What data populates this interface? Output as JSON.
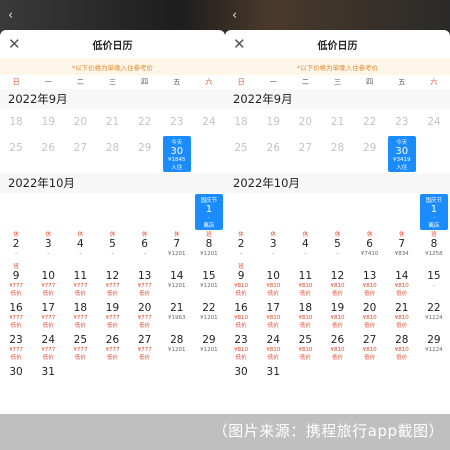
{
  "left": {
    "title": "低价日历",
    "notice": "*以下价格为单晚入住参考价",
    "weekdays": [
      "日",
      "一",
      "二",
      "三",
      "四",
      "五",
      "六"
    ],
    "sep": {
      "header": "2022年9月",
      "row1": [
        "18",
        "19",
        "20",
        "21",
        "22",
        "23",
        "24"
      ],
      "row2": [
        "25",
        "26",
        "27",
        "28",
        "29"
      ],
      "today": {
        "tag": "今天",
        "day": "30",
        "price": "¥1845",
        "note": "入住"
      }
    },
    "oct": {
      "header": "2022年10月",
      "holiday": {
        "tag": "国庆节",
        "day": "1",
        "price": "-",
        "note": "离店"
      },
      "r1": [
        {
          "tag": "休",
          "d": "2",
          "p": "-"
        },
        {
          "tag": "休",
          "d": "3",
          "p": "-"
        },
        {
          "tag": "休",
          "d": "4",
          "p": "-"
        },
        {
          "tag": "休",
          "d": "5",
          "p": "-"
        },
        {
          "tag": "休",
          "d": "6",
          "p": "-"
        },
        {
          "tag": "休",
          "d": "7",
          "p": "¥1201"
        },
        {
          "tag": "班",
          "d": "8",
          "p": "¥1201"
        }
      ],
      "r2": [
        {
          "tag": "班",
          "d": "9",
          "p": "¥777",
          "lo": "低价"
        },
        {
          "tag": "",
          "d": "10",
          "p": "¥777",
          "lo": "低价"
        },
        {
          "tag": "",
          "d": "11",
          "p": "¥777",
          "lo": "低价"
        },
        {
          "tag": "",
          "d": "12",
          "p": "¥777",
          "lo": "低价"
        },
        {
          "tag": "",
          "d": "13",
          "p": "¥777",
          "lo": "低价"
        },
        {
          "tag": "",
          "d": "14",
          "p": "¥1201"
        },
        {
          "tag": "",
          "d": "15",
          "p": "¥1201"
        }
      ],
      "r3": [
        {
          "tag": "",
          "d": "16",
          "p": "¥777",
          "lo": "低价"
        },
        {
          "tag": "",
          "d": "17",
          "p": "¥777",
          "lo": "低价"
        },
        {
          "tag": "",
          "d": "18",
          "p": "¥777",
          "lo": "低价"
        },
        {
          "tag": "",
          "d": "19",
          "p": "¥777",
          "lo": "低价"
        },
        {
          "tag": "",
          "d": "20",
          "p": "¥777",
          "lo": "低价"
        },
        {
          "tag": "",
          "d": "21",
          "p": "¥1963"
        },
        {
          "tag": "",
          "d": "22",
          "p": "¥1201"
        }
      ],
      "r4": [
        {
          "tag": "",
          "d": "23",
          "p": "¥777",
          "lo": "低价"
        },
        {
          "tag": "",
          "d": "24",
          "p": "¥777",
          "lo": "低价"
        },
        {
          "tag": "",
          "d": "25",
          "p": "¥777",
          "lo": "低价"
        },
        {
          "tag": "",
          "d": "26",
          "p": "¥777",
          "lo": "低价"
        },
        {
          "tag": "",
          "d": "27",
          "p": "¥777",
          "lo": "低价"
        },
        {
          "tag": "",
          "d": "28",
          "p": "¥1201"
        },
        {
          "tag": "",
          "d": "29",
          "p": "¥1201"
        }
      ],
      "r5": [
        "30",
        "31"
      ]
    }
  },
  "right": {
    "title": "低价日历",
    "notice": "*以下价格为单晚入住参考价",
    "weekdays": [
      "日",
      "一",
      "二",
      "三",
      "四",
      "五",
      "六"
    ],
    "sep": {
      "header": "2022年9月",
      "row1": [
        "18",
        "19",
        "20",
        "21",
        "22",
        "23",
        "24"
      ],
      "row2": [
        "25",
        "26",
        "27",
        "28",
        "29"
      ],
      "today": {
        "tag": "今天",
        "day": "30",
        "price": "¥3419",
        "note": "入住"
      }
    },
    "oct": {
      "header": "2022年10月",
      "holiday": {
        "tag": "国庆节",
        "day": "1",
        "price": "-",
        "note": "离店"
      },
      "r1": [
        {
          "tag": "休",
          "d": "2",
          "p": "-"
        },
        {
          "tag": "休",
          "d": "3",
          "p": "-"
        },
        {
          "tag": "休",
          "d": "4",
          "p": "-"
        },
        {
          "tag": "休",
          "d": "5",
          "p": "-"
        },
        {
          "tag": "休",
          "d": "6",
          "p": "¥7410"
        },
        {
          "tag": "休",
          "d": "7",
          "p": "¥834"
        },
        {
          "tag": "班",
          "d": "8",
          "p": "¥1258"
        }
      ],
      "r2": [
        {
          "tag": "班",
          "d": "9",
          "p": "¥810",
          "lo": "低价"
        },
        {
          "tag": "",
          "d": "10",
          "p": "¥810",
          "lo": "低价"
        },
        {
          "tag": "",
          "d": "11",
          "p": "¥810",
          "lo": "低价"
        },
        {
          "tag": "",
          "d": "12",
          "p": "¥810",
          "lo": "低价"
        },
        {
          "tag": "",
          "d": "13",
          "p": "¥810",
          "lo": "低价"
        },
        {
          "tag": "",
          "d": "14",
          "p": "¥810",
          "lo": "低价"
        },
        {
          "tag": "",
          "d": "15",
          "p": "-"
        }
      ],
      "r3": [
        {
          "tag": "",
          "d": "16",
          "p": "¥810",
          "lo": "低价"
        },
        {
          "tag": "",
          "d": "17",
          "p": "¥810",
          "lo": "低价"
        },
        {
          "tag": "",
          "d": "18",
          "p": "¥810",
          "lo": "低价"
        },
        {
          "tag": "",
          "d": "19",
          "p": "¥810",
          "lo": "低价"
        },
        {
          "tag": "",
          "d": "20",
          "p": "¥810",
          "lo": "低价"
        },
        {
          "tag": "",
          "d": "21",
          "p": "¥810",
          "lo": "低价"
        },
        {
          "tag": "",
          "d": "22",
          "p": "¥1224"
        }
      ],
      "r4": [
        {
          "tag": "",
          "d": "23",
          "p": "¥810",
          "lo": "低价"
        },
        {
          "tag": "",
          "d": "24",
          "p": "¥810",
          "lo": "低价"
        },
        {
          "tag": "",
          "d": "25",
          "p": "¥810",
          "lo": "低价"
        },
        {
          "tag": "",
          "d": "26",
          "p": "¥810",
          "lo": "低价"
        },
        {
          "tag": "",
          "d": "27",
          "p": "¥810",
          "lo": "低价"
        },
        {
          "tag": "",
          "d": "28",
          "p": "¥810",
          "lo": "低价"
        },
        {
          "tag": "",
          "d": "29",
          "p": "¥1224"
        }
      ],
      "r5": [
        "30",
        "31"
      ]
    }
  },
  "credit": "（图片来源：携程旅行app截图）",
  "colors": {
    "accent": "#1a8cff",
    "holiday": "#e0482b",
    "notice_bg": "#fff6ea",
    "notice_text": "#e08a2c"
  }
}
